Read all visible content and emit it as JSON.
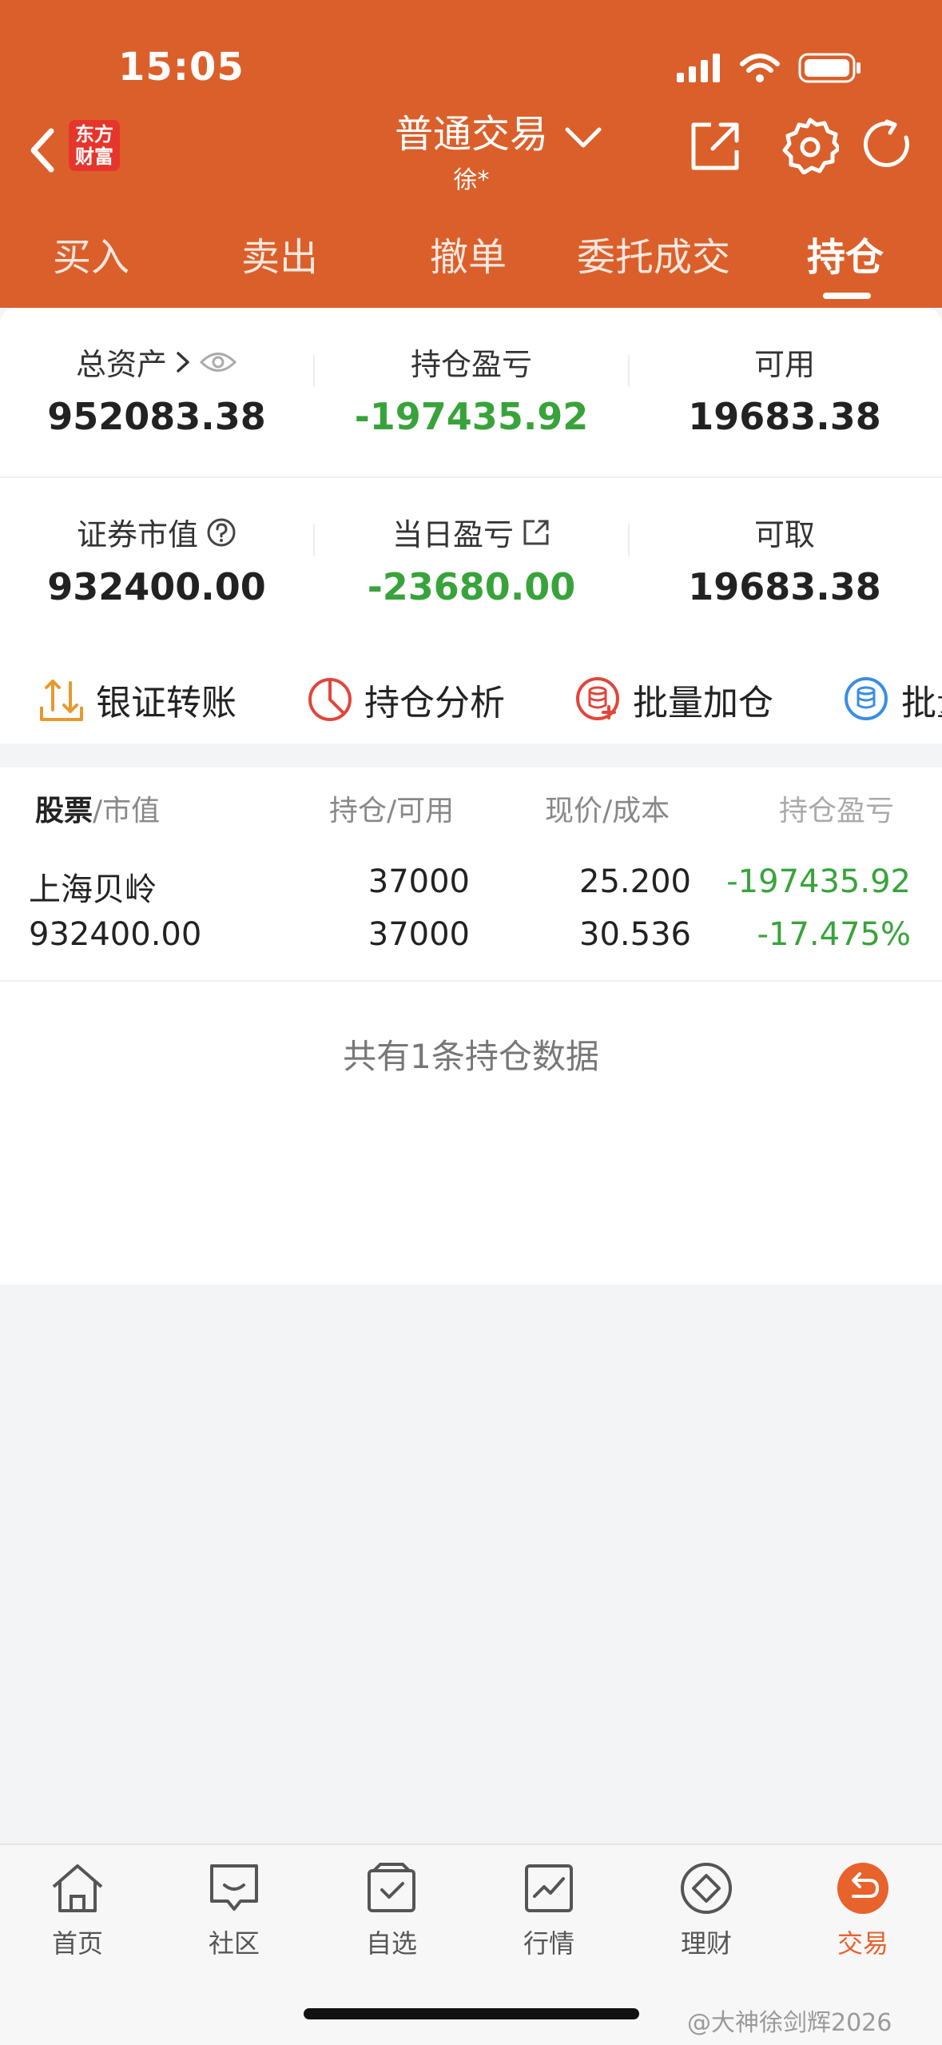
{
  "status_bar": {
    "time": "15:05"
  },
  "header": {
    "logo_text_1": "东方",
    "logo_text_2": "财富",
    "title": "普通交易",
    "subtitle": "徐*"
  },
  "tabs": [
    {
      "label": "买入"
    },
    {
      "label": "卖出"
    },
    {
      "label": "撤单"
    },
    {
      "label": "委托成交"
    },
    {
      "label": "持仓",
      "active": true
    }
  ],
  "summary": {
    "total_assets": {
      "label": "总资产",
      "value": "952083.38"
    },
    "position_pnl": {
      "label": "持仓盈亏",
      "value": "-197435.92"
    },
    "available": {
      "label": "可用",
      "value": "19683.38"
    },
    "market_value": {
      "label": "证券市值",
      "value": "932400.00"
    },
    "daily_pnl": {
      "label": "当日盈亏",
      "value": "-23680.00"
    },
    "withdrawable": {
      "label": "可取",
      "value": "19683.38"
    }
  },
  "quick_actions": [
    {
      "label": "银证转账",
      "icon": "transfer-icon"
    },
    {
      "label": "持仓分析",
      "icon": "pie-chart-icon"
    },
    {
      "label": "批量加仓",
      "icon": "batch-add-icon"
    },
    {
      "label": "批量",
      "icon": "batch-icon"
    }
  ],
  "table": {
    "headers": {
      "stock": "股票",
      "market_value": "/市值",
      "holding": "持仓/可用",
      "price": "现价/成本",
      "pnl": "持仓盈亏"
    },
    "rows": [
      {
        "name": "上海贝岭",
        "market_value": "932400.00",
        "holding": "37000",
        "available": "37000",
        "price": "25.200",
        "cost": "30.536",
        "pnl": "-197435.92",
        "pnl_pct": "-17.475%"
      }
    ],
    "footnote": "共有1条持仓数据"
  },
  "bottom_nav": [
    {
      "label": "首页",
      "icon": "home-icon"
    },
    {
      "label": "社区",
      "icon": "chat-icon"
    },
    {
      "label": "自选",
      "icon": "watchlist-icon"
    },
    {
      "label": "行情",
      "icon": "trend-chart-icon"
    },
    {
      "label": "理财",
      "icon": "diamond-icon"
    },
    {
      "label": "交易",
      "icon": "trade-icon",
      "active": true
    }
  ],
  "watermark": "@大神徐剑辉2026",
  "colors": {
    "brand": "#DB5F2A",
    "loss": "#38A33B",
    "active_nav": "#E8622C"
  }
}
